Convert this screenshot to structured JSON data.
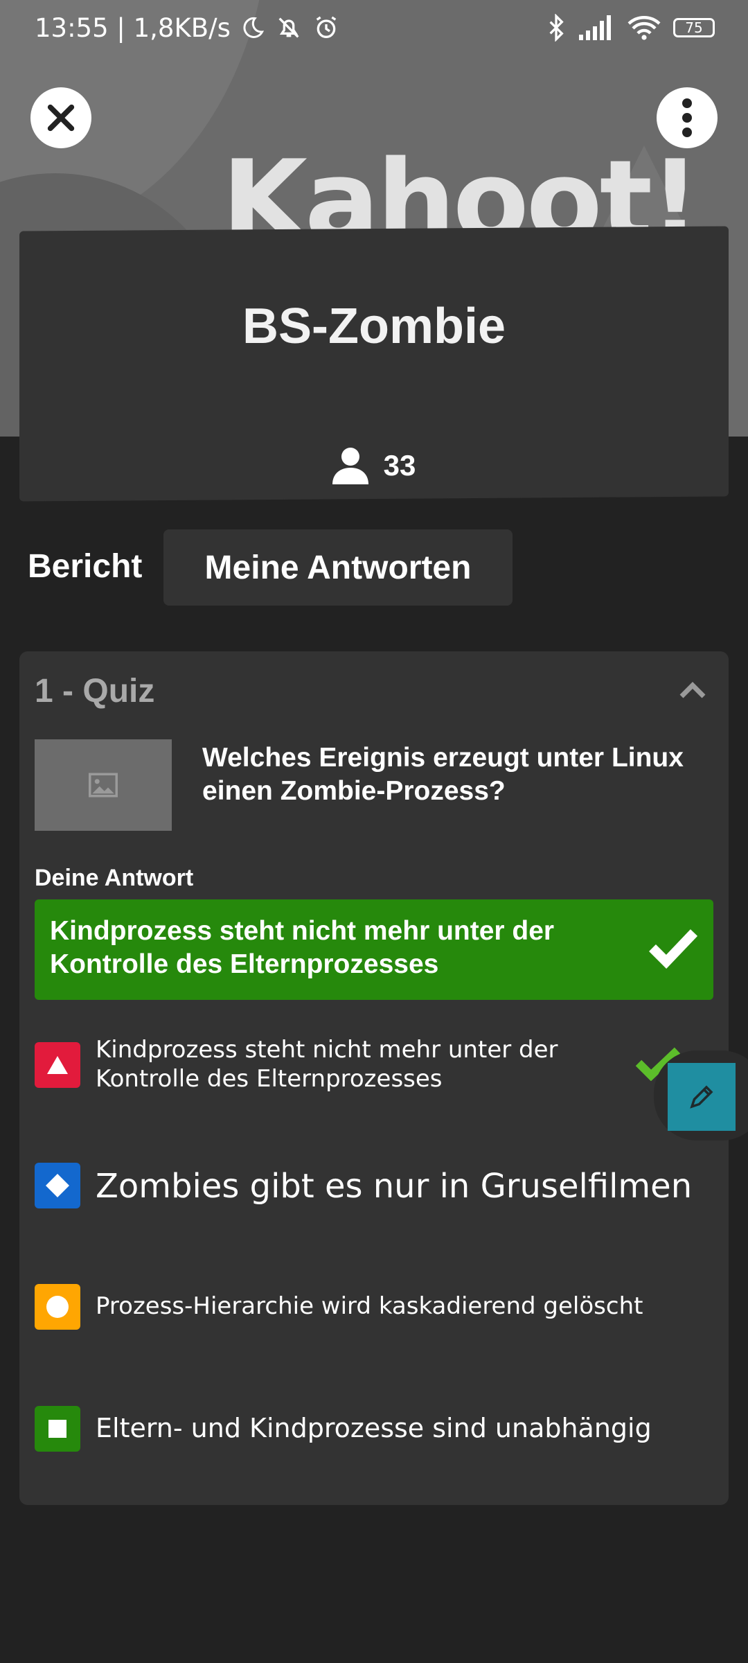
{
  "status_bar": {
    "time_speed": "13:55 | 1,8KB/s",
    "battery": "75"
  },
  "header": {
    "watermark": "Kahoot!",
    "title": "BS-Zombie",
    "player_count": "33"
  },
  "tabs": {
    "partial_label": "Bericht",
    "active_label": "Meine Antworten"
  },
  "question_card": {
    "heading": "1 - Quiz",
    "question": "Welches Ereignis erzeugt unter Linux einen Zombie-Prozess?",
    "your_answer_label": "Deine Antwort",
    "your_answer": "Kindprozess steht nicht mehr unter der Kontrolle des Elternprozesses",
    "options": [
      {
        "shape": "triangle",
        "color": "#e21b3c",
        "text": "Kindprozess steht nicht mehr unter der Kontrolle des Elternprozesses",
        "correct": true
      },
      {
        "shape": "diamond",
        "color": "#1368ce",
        "text": "Zombies gibt es nur in Gruselfilmen",
        "correct": false
      },
      {
        "shape": "circle",
        "color": "#ffa602",
        "text": "Prozess-Hierarchie wird kaskadierend gelöscht",
        "correct": false
      },
      {
        "shape": "square",
        "color": "#26890c",
        "text": "Eltern- und Kindprozesse sind unabhängig",
        "correct": false
      }
    ]
  }
}
